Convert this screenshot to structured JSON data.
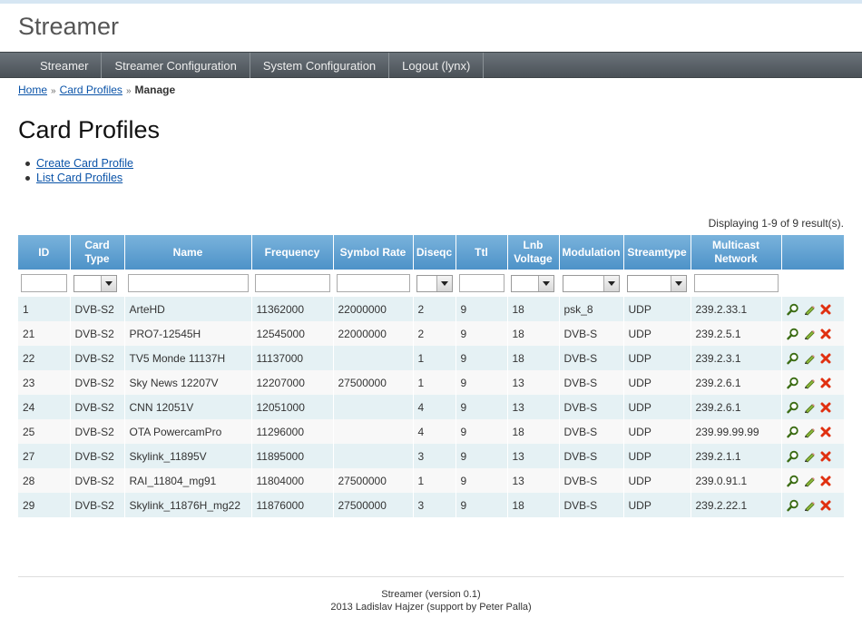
{
  "app": {
    "title": "Streamer"
  },
  "menu": [
    {
      "label": "Streamer"
    },
    {
      "label": "Streamer Configuration"
    },
    {
      "label": "System Configuration"
    },
    {
      "label": "Logout (lynx)"
    }
  ],
  "breadcrumbs": {
    "home": "Home",
    "section": "Card Profiles",
    "current": "Manage",
    "separator": "»"
  },
  "page": {
    "title": "Card Profiles"
  },
  "operations": [
    {
      "label": "Create Card Profile"
    },
    {
      "label": "List Card Profiles"
    }
  ],
  "grid": {
    "summary": "Displaying 1-9 of 9 result(s).",
    "columns": {
      "id": "ID",
      "card_type": "Card Type",
      "name": "Name",
      "frequency": "Frequency",
      "symbol_rate": "Symbol Rate",
      "diseqc": "Diseqc",
      "ttl": "Ttl",
      "lnb_voltage": "Lnb Voltage",
      "modulation": "Modulation",
      "streamtype": "Streamtype",
      "multicast_network": "Multicast Network"
    },
    "rows": [
      {
        "id": "1",
        "card_type": "DVB-S2",
        "name": "ArteHD",
        "frequency": "11362000",
        "symbol_rate": "22000000",
        "diseqc": "2",
        "ttl": "9",
        "lnb_voltage": "18",
        "modulation": "psk_8",
        "streamtype": "UDP",
        "multicast_network": "239.2.33.1"
      },
      {
        "id": "21",
        "card_type": "DVB-S2",
        "name": "PRO7-12545H",
        "frequency": "12545000",
        "symbol_rate": "22000000",
        "diseqc": "2",
        "ttl": "9",
        "lnb_voltage": "18",
        "modulation": "DVB-S",
        "streamtype": "UDP",
        "multicast_network": "239.2.5.1"
      },
      {
        "id": "22",
        "card_type": "DVB-S2",
        "name": "TV5 Monde 11137H",
        "frequency": "11137000",
        "symbol_rate": "",
        "diseqc": "1",
        "ttl": "9",
        "lnb_voltage": "18",
        "modulation": "DVB-S",
        "streamtype": "UDP",
        "multicast_network": "239.2.3.1"
      },
      {
        "id": "23",
        "card_type": "DVB-S2",
        "name": "Sky News 12207V",
        "frequency": "12207000",
        "symbol_rate": "27500000",
        "diseqc": "1",
        "ttl": "9",
        "lnb_voltage": "13",
        "modulation": "DVB-S",
        "streamtype": "UDP",
        "multicast_network": "239.2.6.1"
      },
      {
        "id": "24",
        "card_type": "DVB-S2",
        "name": "CNN 12051V",
        "frequency": "12051000",
        "symbol_rate": "",
        "diseqc": "4",
        "ttl": "9",
        "lnb_voltage": "13",
        "modulation": "DVB-S",
        "streamtype": "UDP",
        "multicast_network": "239.2.6.1"
      },
      {
        "id": "25",
        "card_type": "DVB-S2",
        "name": "OTA PowercamPro",
        "frequency": "11296000",
        "symbol_rate": "",
        "diseqc": "4",
        "ttl": "9",
        "lnb_voltage": "18",
        "modulation": "DVB-S",
        "streamtype": "UDP",
        "multicast_network": "239.99.99.99"
      },
      {
        "id": "27",
        "card_type": "DVB-S2",
        "name": "Skylink_11895V",
        "frequency": "11895000",
        "symbol_rate": "",
        "diseqc": "3",
        "ttl": "9",
        "lnb_voltage": "13",
        "modulation": "DVB-S",
        "streamtype": "UDP",
        "multicast_network": "239.2.1.1"
      },
      {
        "id": "28",
        "card_type": "DVB-S2",
        "name": "RAI_11804_mg91",
        "frequency": "11804000",
        "symbol_rate": "27500000",
        "diseqc": "1",
        "ttl": "9",
        "lnb_voltage": "13",
        "modulation": "DVB-S",
        "streamtype": "UDP",
        "multicast_network": "239.0.91.1"
      },
      {
        "id": "29",
        "card_type": "DVB-S2",
        "name": "Skylink_11876H_mg22",
        "frequency": "11876000",
        "symbol_rate": "27500000",
        "diseqc": "3",
        "ttl": "9",
        "lnb_voltage": "18",
        "modulation": "DVB-S",
        "streamtype": "UDP",
        "multicast_network": "239.2.22.1"
      }
    ],
    "row_actions": [
      "magnifier-icon",
      "pencil-icon",
      "delete-x-icon"
    ]
  },
  "footer": {
    "line1": "Streamer (version 0.1)",
    "line2": "2013 Ladislav Hajzer (support by Peter Palla)"
  },
  "colors": {
    "header_grad_top": "#7ab3dc",
    "header_grad_bottom": "#4d92c8",
    "menu_bg": "#5a6167",
    "link": "#0a53a8",
    "row_odd": "#e5f1f4",
    "row_even": "#f8f8f8",
    "delete": "#e03010",
    "edit": "#5c8a1e"
  }
}
